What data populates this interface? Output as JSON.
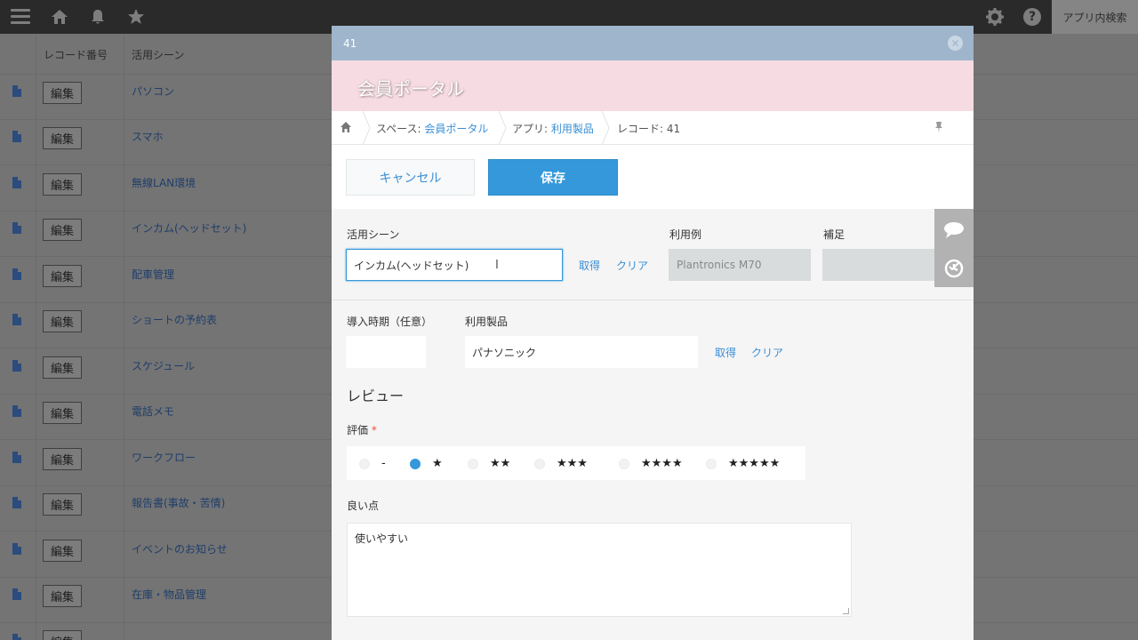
{
  "topbar": {
    "icons": [
      "menu-icon",
      "home-icon",
      "bell-icon",
      "star-icon",
      "gear-icon",
      "help-icon"
    ],
    "app_search_label": "アプリ内検索"
  },
  "list": {
    "headers": {
      "record_number": "レコード番号",
      "scene": "活用シーン"
    },
    "edit_label": "編集",
    "rows": [
      {
        "scene": "パソコン"
      },
      {
        "scene": "スマホ"
      },
      {
        "scene": "無線LAN環境"
      },
      {
        "scene": "インカム(ヘッドセット)"
      },
      {
        "scene": "配車管理"
      },
      {
        "scene": "ショートの予約表"
      },
      {
        "scene": "スケジュール"
      },
      {
        "scene": "電話メモ"
      },
      {
        "scene": "ワークフロー"
      },
      {
        "scene": "報告書(事故・苦情)"
      },
      {
        "scene": "イベントのお知らせ"
      },
      {
        "scene": "在庫・物品管理"
      },
      {
        "scene": ""
      }
    ]
  },
  "modal": {
    "record_number": "41",
    "space_title": "会員ポータル",
    "breadcrumb": {
      "space_prefix": "スペース: ",
      "space_name": "会員ポータル",
      "app_prefix": "アプリ: ",
      "app_name": "利用製品",
      "record": "レコード: 41"
    },
    "buttons": {
      "cancel": "キャンセル",
      "save": "保存"
    },
    "fields": {
      "scene_label": "活用シーン",
      "scene_value": "インカム(ヘッドセット)",
      "get_label": "取得",
      "clear_label": "クリア",
      "example_label": "利用例",
      "example_value": "Plantronics M70",
      "note_label": "補足",
      "note_value": "",
      "intro_label": "導入時期（任意）",
      "intro_value": "",
      "product_label": "利用製品",
      "product_value": "パナソニック"
    },
    "review": {
      "title": "レビュー",
      "rating_label": "評価",
      "required_mark": "*",
      "options": [
        "-",
        "★",
        "★★",
        "★★★",
        "★★★★",
        "★★★★★"
      ],
      "selected_index": 1,
      "good_points_label": "良い点",
      "good_points_value": "使いやすい"
    },
    "colors": {
      "accent": "#3498db",
      "title_bar": "#9fb5cc",
      "banner": "#f6dce2"
    }
  }
}
